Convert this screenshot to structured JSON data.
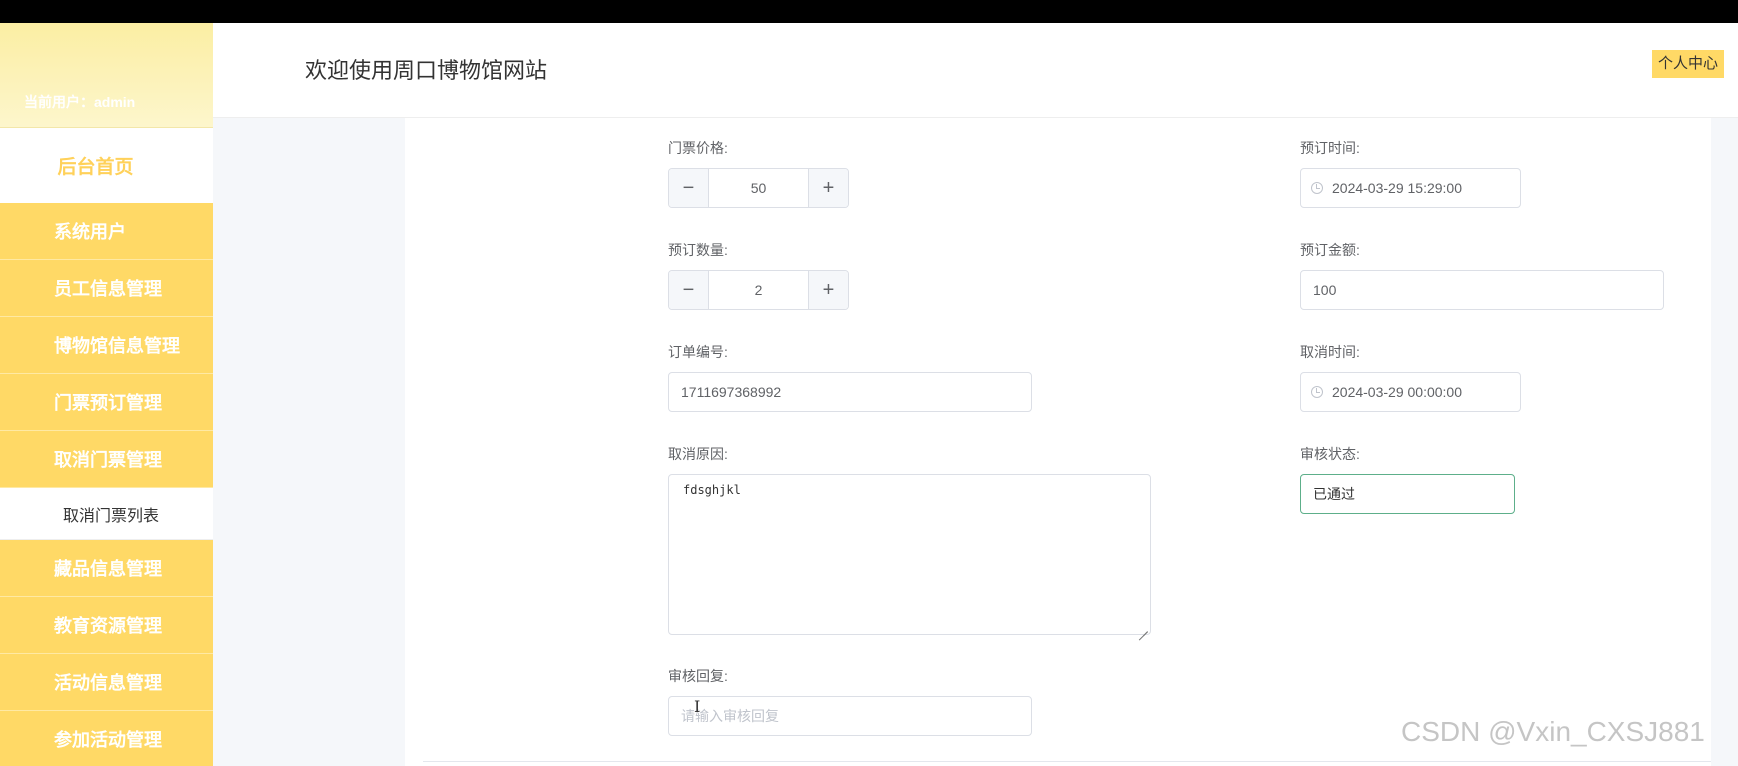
{
  "header": {
    "site_title": "欢迎使用周口博物馆网站",
    "profile_button": "个人中心"
  },
  "sidebar": {
    "current_user_label": "当前用户：admin",
    "home": "后台首页",
    "items": [
      {
        "label": "系统用户"
      },
      {
        "label": "员工信息管理"
      },
      {
        "label": "博物馆信息管理"
      },
      {
        "label": "门票预订管理"
      },
      {
        "label": "取消门票管理"
      }
    ],
    "sub_item": "取消门票列表",
    "items_after": [
      {
        "label": "藏品信息管理"
      },
      {
        "label": "教育资源管理"
      },
      {
        "label": "活动信息管理"
      },
      {
        "label": "参加活动管理"
      }
    ]
  },
  "form": {
    "ticket_price": {
      "label": "门票价格:",
      "value": "50",
      "minus": "−",
      "plus": "+"
    },
    "booking_time": {
      "label": "预订时间:",
      "value": "2024-03-29 15:29:00"
    },
    "booking_quantity": {
      "label": "预订数量:",
      "value": "2",
      "minus": "−",
      "plus": "+"
    },
    "booking_amount": {
      "label": "预订金额:",
      "value": "100"
    },
    "order_number": {
      "label": "订单编号:",
      "value": "1711697368992"
    },
    "cancel_time": {
      "label": "取消时间:",
      "value": "2024-03-29 00:00:00"
    },
    "cancel_reason": {
      "label": "取消原因:",
      "value": "fdsghjkl"
    },
    "review_status": {
      "label": "审核状态:",
      "value": "已通过"
    },
    "review_reply": {
      "label": "审核回复:",
      "placeholder": "请输入审核回复"
    }
  },
  "watermark": "CSDN @Vxin_CXSJ881",
  "icons": {
    "clock": "clock-icon",
    "cursor": "text-cursor-icon"
  }
}
